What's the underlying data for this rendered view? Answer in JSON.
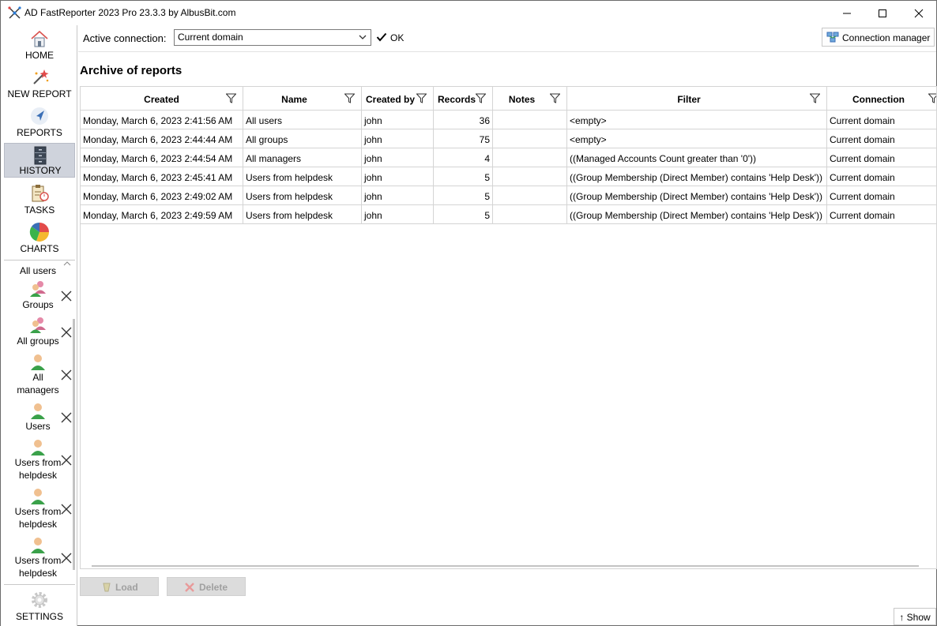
{
  "window": {
    "title": "AD FastReporter 2023 Pro 23.3.3 by AlbusBit.com"
  },
  "nav": {
    "home": "HOME",
    "new_report": "NEW REPORT",
    "reports": "REPORTS",
    "history": "HISTORY",
    "tasks": "TASKS",
    "charts": "CHARTS",
    "settings": "SETTINGS"
  },
  "open_reports": {
    "partial_label": "All users",
    "items": [
      {
        "label_line1": "Groups",
        "label_line2": ""
      },
      {
        "label_line1": "All groups",
        "label_line2": ""
      },
      {
        "label_line1": "All",
        "label_line2": "managers"
      },
      {
        "label_line1": "Users",
        "label_line2": ""
      },
      {
        "label_line1": "Users from",
        "label_line2": "helpdesk"
      },
      {
        "label_line1": "Users from",
        "label_line2": "helpdesk"
      },
      {
        "label_line1": "Users from",
        "label_line2": "helpdesk"
      }
    ]
  },
  "connection": {
    "label": "Active connection:",
    "selected": "Current domain",
    "status": "OK",
    "manager_button": "Connection manager"
  },
  "archive": {
    "title": "Archive of reports",
    "columns": [
      "Created",
      "Name",
      "Created by",
      "Records",
      "Notes",
      "Filter",
      "Connection"
    ],
    "rows": [
      {
        "created": "Monday, March 6, 2023 2:41:56 AM",
        "name": "All users",
        "created_by": "john",
        "records": "36",
        "notes": "",
        "filter": "<empty>",
        "connection": "Current domain"
      },
      {
        "created": "Monday, March 6, 2023 2:44:44 AM",
        "name": "All groups",
        "created_by": "john",
        "records": "75",
        "notes": "",
        "filter": "<empty>",
        "connection": "Current domain"
      },
      {
        "created": "Monday, March 6, 2023 2:44:54 AM",
        "name": "All managers",
        "created_by": "john",
        "records": "4",
        "notes": "",
        "filter": "((Managed Accounts Count greater than '0'))",
        "connection": "Current domain"
      },
      {
        "created": "Monday, March 6, 2023 2:45:41 AM",
        "name": "Users from helpdesk",
        "created_by": "john",
        "records": "5",
        "notes": "",
        "filter": "((Group Membership (Direct Member) contains 'Help Desk'))",
        "connection": "Current domain"
      },
      {
        "created": "Monday, March 6, 2023 2:49:02 AM",
        "name": "Users from helpdesk",
        "created_by": "john",
        "records": "5",
        "notes": "",
        "filter": "((Group Membership (Direct Member) contains 'Help Desk'))",
        "connection": "Current domain"
      },
      {
        "created": "Monday, March 6, 2023 2:49:59 AM",
        "name": "Users from helpdesk",
        "created_by": "john",
        "records": "5",
        "notes": "",
        "filter": "((Group Membership (Direct Member) contains 'Help Desk'))",
        "connection": "Current domain"
      }
    ]
  },
  "actions": {
    "load": "Load",
    "delete": "Delete",
    "show": "Show"
  },
  "colors": {
    "active_nav": "#cfd3dc",
    "grid_border": "#d4d4d4",
    "disabled_button": "#dcdcdc"
  }
}
